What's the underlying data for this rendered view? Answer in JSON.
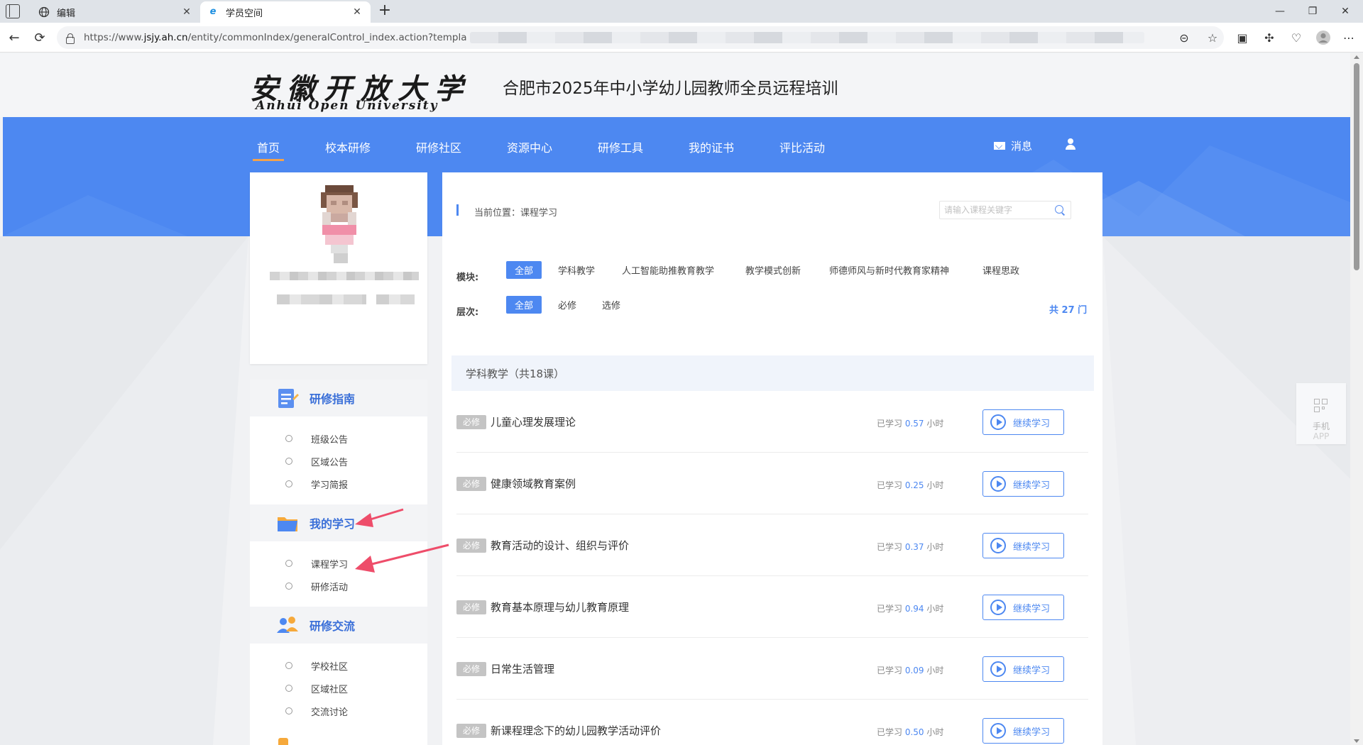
{
  "browser": {
    "tabs": [
      {
        "label": "编辑",
        "active": false
      },
      {
        "label": "学员空间",
        "active": true
      }
    ],
    "url_prefix": "https://www.",
    "url_host": "jsjy.ah.cn",
    "url_path": "/entity/commonIndex/generalControl_index.action?templa"
  },
  "header": {
    "logo_cn": "安徽开放大学",
    "logo_en": "Anhui Open University",
    "site_title": "合肥市2025年中小学幼儿园教师全员远程培训"
  },
  "nav": {
    "items": [
      "首页",
      "校本研修",
      "研修社区",
      "资源中心",
      "研修工具",
      "我的证书",
      "评比活动"
    ],
    "messages": "消息"
  },
  "sidebar": {
    "sections": [
      {
        "title": "研修指南",
        "items": [
          "班级公告",
          "区域公告",
          "学习简报"
        ]
      },
      {
        "title": "我的学习",
        "items": [
          "课程学习",
          "研修活动"
        ]
      },
      {
        "title": "研修交流",
        "items": [
          "学校社区",
          "区域社区",
          "交流讨论"
        ]
      }
    ]
  },
  "content": {
    "breadcrumb": "当前位置：课程学习",
    "search_placeholder": "请输入课程关键字",
    "module_label": "模块:",
    "modules": [
      "全部",
      "学科教学",
      "人工智能助推教育教学",
      "教学模式创新",
      "师德师风与新时代教育家精神",
      "课程思政"
    ],
    "level_label": "层次:",
    "levels": [
      "全部",
      "必修",
      "选修"
    ],
    "total": "共 27 门",
    "group_title": "学科教学（共18课）",
    "courses": [
      {
        "tag": "必修",
        "name": "儿童心理发展理论",
        "studied_prefix": "已学习",
        "hours": "0.57",
        "unit": "小时",
        "action": "继续学习"
      },
      {
        "tag": "必修",
        "name": "健康领域教育案例",
        "studied_prefix": "已学习",
        "hours": "0.25",
        "unit": "小时",
        "action": "继续学习"
      },
      {
        "tag": "必修",
        "name": "教育活动的设计、组织与评价",
        "studied_prefix": "已学习",
        "hours": "0.37",
        "unit": "小时",
        "action": "继续学习"
      },
      {
        "tag": "必修",
        "name": "教育基本原理与幼儿教育原理",
        "studied_prefix": "已学习",
        "hours": "0.94",
        "unit": "小时",
        "action": "继续学习"
      },
      {
        "tag": "必修",
        "name": "日常生活管理",
        "studied_prefix": "已学习",
        "hours": "0.09",
        "unit": "小时",
        "action": "继续学习"
      },
      {
        "tag": "必修",
        "name": "新课程理念下的幼儿园教学活动评价",
        "studied_prefix": "已学习",
        "hours": "0.50",
        "unit": "小时",
        "action": "继续学习"
      }
    ]
  },
  "app_float": {
    "line1": "手机",
    "line2": "APP"
  },
  "colors": {
    "accent": "#4d88f1",
    "nav_active_underline": "#f4a24b",
    "annotation_arrow": "#ee4d6a"
  }
}
